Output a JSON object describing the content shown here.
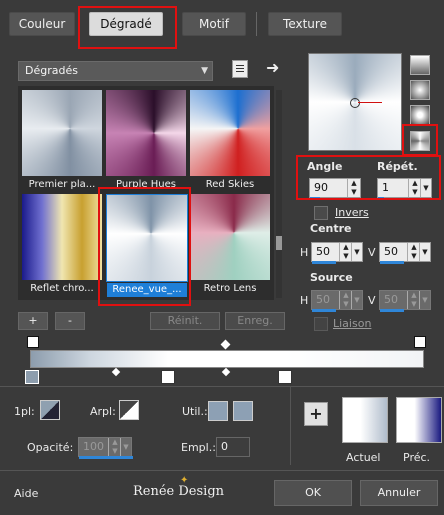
{
  "tabs": {
    "couleur": "Couleur",
    "degrade": "Dégradé",
    "motif": "Motif",
    "texture": "Texture"
  },
  "category_dropdown": {
    "value": "Dégradés"
  },
  "gradients": [
    {
      "label": "Premier pla..."
    },
    {
      "label": "Purple Hues"
    },
    {
      "label": "Red Skies"
    },
    {
      "label": "Reflet chro..."
    },
    {
      "label": "Renee_vue_..."
    },
    {
      "label": "Retro Lens"
    }
  ],
  "list_buttons": {
    "add": "+",
    "remove": "-",
    "reset": "Réinit.",
    "save": "Enreg."
  },
  "angle": {
    "label": "Angle",
    "value": "90"
  },
  "repeat": {
    "label": "Répét.",
    "value": "1"
  },
  "invert": {
    "label": "Invers"
  },
  "center": {
    "label": "Centre",
    "h_label": "H",
    "h_value": "50",
    "v_label": "V",
    "v_value": "50"
  },
  "source": {
    "label": "Source",
    "h_label": "H",
    "h_value": "50",
    "v_label": "V",
    "v_value": "50"
  },
  "link": {
    "label": "Liaison"
  },
  "stops": {
    "first_label": "1pl:",
    "arpl_label": "Arpl:",
    "util_label": "Util.:",
    "opacity_label": "Opacité:",
    "opacity_value": "100",
    "empl_label": "Empl.:",
    "empl_value": "0"
  },
  "preview": {
    "current": "Actuel",
    "previous": "Préc."
  },
  "footer": {
    "help": "Aide",
    "logo": "Renée Design",
    "ok": "OK",
    "cancel": "Annuler"
  },
  "colors": {
    "accent_red": "#e01010",
    "selection_blue": "#1e7fd8"
  }
}
